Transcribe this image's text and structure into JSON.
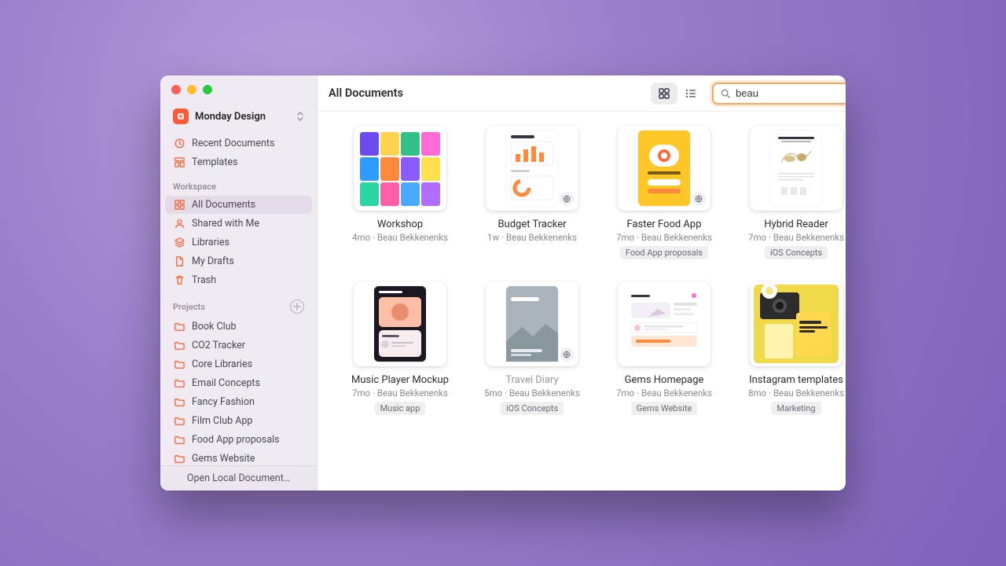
{
  "window": {
    "team_name": "Monday Design",
    "page_title": "All Documents",
    "search_value": "beau",
    "footer_button": "Open Local Document…"
  },
  "sidebar": {
    "top": [
      {
        "label": "Recent Documents",
        "icon": "clock"
      },
      {
        "label": "Templates",
        "icon": "templates"
      }
    ],
    "workspace_header": "Workspace",
    "workspace": [
      {
        "label": "All Documents",
        "icon": "grid",
        "selected": true
      },
      {
        "label": "Shared with Me",
        "icon": "person"
      },
      {
        "label": "Libraries",
        "icon": "stack"
      },
      {
        "label": "My Drafts",
        "icon": "doc"
      },
      {
        "label": "Trash",
        "icon": "trash"
      }
    ],
    "projects_header": "Projects",
    "projects": [
      {
        "label": "Book Club"
      },
      {
        "label": "CO2 Tracker"
      },
      {
        "label": "Core Libraries"
      },
      {
        "label": "Email Concepts"
      },
      {
        "label": "Fancy Fashion"
      },
      {
        "label": "Film Club App"
      },
      {
        "label": "Food App proposals"
      },
      {
        "label": "Gems Website"
      }
    ]
  },
  "documents": [
    {
      "title": "Workshop",
      "meta": "4mo · Beau Bekkenenks",
      "tag": "",
      "shared": false,
      "thumb": "workshop"
    },
    {
      "title": "Budget Tracker",
      "meta": "1w · Beau Bekkenenks",
      "tag": "",
      "shared": true,
      "thumb": "budget"
    },
    {
      "title": "Faster Food App",
      "meta": "7mo · Beau Bekkenenks",
      "tag": "Food App proposals",
      "shared": true,
      "thumb": "food"
    },
    {
      "title": "Hybrid Reader",
      "meta": "7mo · Beau Bekkenenks",
      "tag": "iOS Concepts",
      "shared": false,
      "thumb": "reader"
    },
    {
      "title": "Music Player Mockup",
      "meta": "7mo · Beau Bekkenenks",
      "tag": "Music app",
      "shared": false,
      "thumb": "music"
    },
    {
      "title": "Travel Diary",
      "meta": "5mo · Beau Bekkenenks",
      "tag": "iOS Concepts",
      "shared": true,
      "thumb": "travel"
    },
    {
      "title": "Gems Homepage",
      "meta": "7mo · Beau Bekkenenks",
      "tag": "Gems Website",
      "shared": false,
      "thumb": "gems"
    },
    {
      "title": "Instagram templates",
      "meta": "8mo · Beau Bekkenenks",
      "tag": "Marketing",
      "shared": false,
      "thumb": "insta"
    }
  ]
}
